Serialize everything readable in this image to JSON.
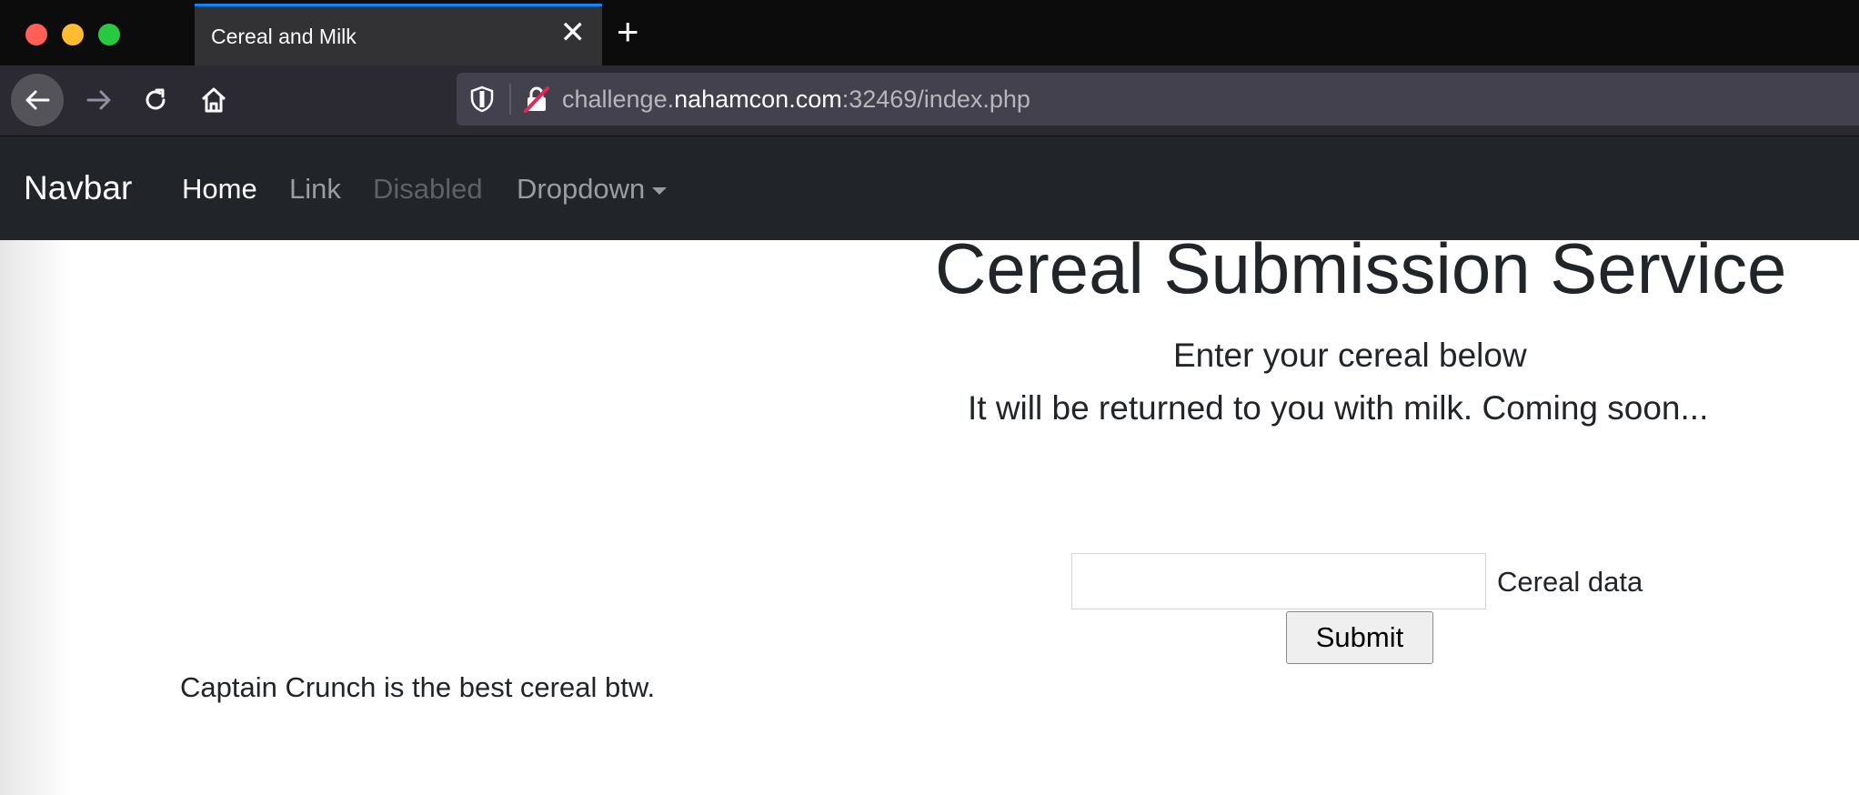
{
  "browser": {
    "tab": {
      "title": "Cereal and Milk",
      "close": "✕"
    },
    "new_tab": "+",
    "url": {
      "subdomain": "challenge.",
      "domain": "nahamcon.com",
      "rest": ":32469/index.php"
    }
  },
  "navbar": {
    "brand": "Navbar",
    "links": [
      "Home",
      "Link",
      "Disabled",
      "Dropdown"
    ]
  },
  "main": {
    "heading": "Cereal Submission Service",
    "subtitle_1": "Enter your cereal below",
    "subtitle_2": "It will be returned to you with milk. Coming soon...",
    "input_value": "",
    "input_label": "Cereal data",
    "submit_label": "Submit",
    "footnote": "Captain Crunch is the best cereal btw."
  },
  "colors": {
    "tab_accent": "#0a84ff",
    "navbar_bg": "#212529",
    "text": "#212529"
  },
  "icons": [
    "close-icon",
    "plus-icon",
    "back-arrow-icon",
    "forward-arrow-icon",
    "reload-icon",
    "home-icon",
    "shield-icon",
    "insecure-lock-icon",
    "caret-down-icon"
  ]
}
